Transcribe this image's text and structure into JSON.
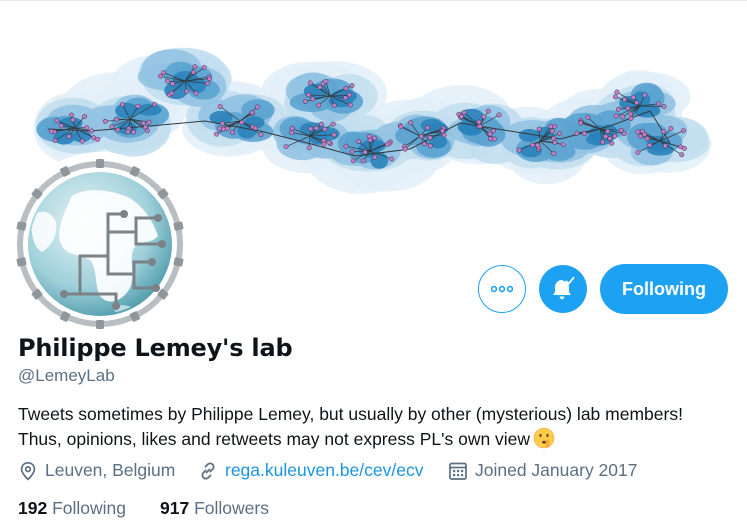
{
  "profile": {
    "display_name": "Philippe Lemey's lab",
    "handle": "@LemeyLab",
    "bio_line1": "Tweets sometimes by Philippe Lemey, but usually by other (mysterious) lab members!",
    "bio_line2": "Thus, opinions, likes and retweets may not express PL's own view",
    "bio_emoji": "shushing-face-emoji",
    "location": "Leuven, Belgium",
    "website": "rega.kuleuven.be/cev/ecv",
    "joined": "Joined January 2017"
  },
  "actions": {
    "more_icon": "more-horizontal-icon",
    "notify_icon": "bell-checked-icon",
    "follow_label": "Following"
  },
  "stats": {
    "following_count": "192",
    "following_label": "Following",
    "followers_count": "917",
    "followers_label": "Followers"
  },
  "icons": {
    "location": "location-pin-icon",
    "website": "link-icon",
    "joined": "calendar-icon"
  },
  "colors": {
    "accent": "#1da1f2",
    "link": "#1b95e0",
    "secondary_text": "#5b7083",
    "primary_text": "#0f1419",
    "network_nodes": "#c27ec7",
    "density_blue": "#2b83ba"
  }
}
